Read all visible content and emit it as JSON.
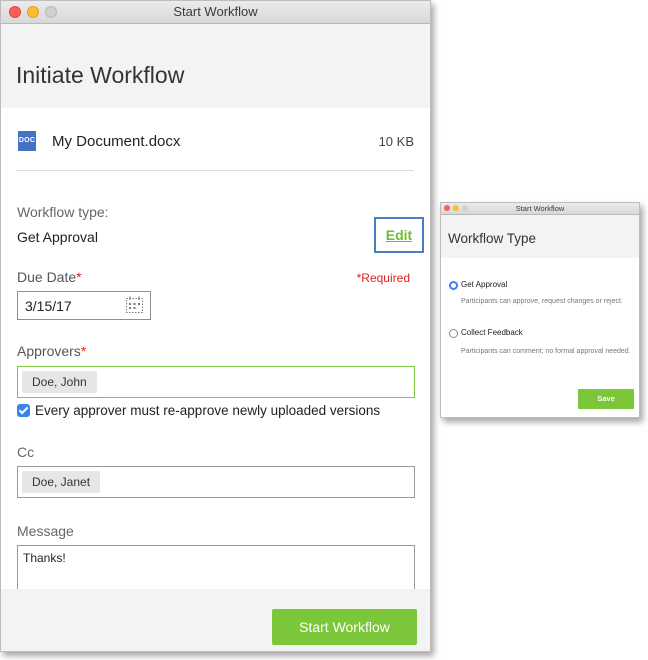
{
  "main_window": {
    "title": "Start Workflow",
    "heading": "Initiate Workflow",
    "file": {
      "icon_label": "DOC",
      "name": "My Document.docx",
      "size": "10 KB"
    },
    "workflow_type": {
      "label": "Workflow type:",
      "value": "Get Approval",
      "edit_label": "Edit"
    },
    "due_date": {
      "label": "Due Date",
      "required_mark": "*",
      "required_note": "*Required",
      "value": "3/15/17"
    },
    "approvers": {
      "label": "Approvers",
      "required_mark": "*",
      "chips": [
        "Doe, John"
      ]
    },
    "reapprove": {
      "checked": true,
      "label": "Every approver must re-approve newly uploaded versions"
    },
    "cc": {
      "label": "Cc",
      "chips": [
        "Doe, Janet"
      ]
    },
    "message": {
      "label": "Message",
      "value": "Thanks!"
    },
    "start_button": "Start Workflow"
  },
  "type_window": {
    "title": "Start Workflow",
    "heading": "Workflow Type",
    "options": [
      {
        "label": "Get Approval",
        "description": "Participants can approve, request changes or reject.",
        "selected": true
      },
      {
        "label": "Collect Feedback",
        "description": "Participants can comment; no formal approval needed.",
        "selected": false
      }
    ],
    "save_button": "Save"
  },
  "colors": {
    "accent_green": "#7cc63a",
    "link_green": "#6cbf2e",
    "required_red": "#e02020",
    "checkbox_blue": "#3b82f0",
    "highlight_blue": "#4a7ec3",
    "doc_blue": "#4472c4"
  }
}
